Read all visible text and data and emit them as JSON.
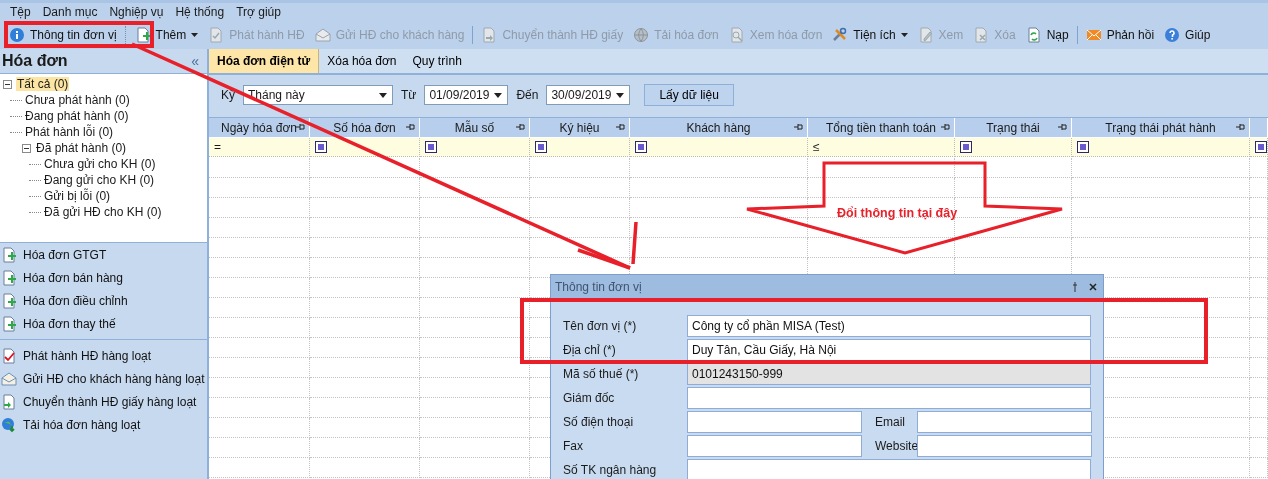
{
  "menu": [
    "Tệp",
    "Danh mục",
    "Nghiệp vụ",
    "Hệ thống",
    "Trợ giúp"
  ],
  "toolbar": [
    [
      {
        "label": "Thông tin đơn vị",
        "disabled": false,
        "dropdown": false
      }
    ],
    [
      {
        "label": "Thêm",
        "disabled": false,
        "dropdown": true
      },
      {
        "label": "Phát hành HĐ",
        "disabled": true,
        "dropdown": false
      },
      {
        "label": "Gửi HĐ cho khách hàng",
        "disabled": true,
        "dropdown": false
      }
    ],
    [
      {
        "label": "Chuyển thành HĐ giấy",
        "disabled": true,
        "dropdown": false
      },
      {
        "label": "Tải hóa đơn",
        "disabled": true,
        "dropdown": false
      },
      {
        "label": "Xem hóa đơn",
        "disabled": true,
        "dropdown": false
      },
      {
        "label": "Tiện ích",
        "disabled": false,
        "dropdown": true
      },
      {
        "label": "Xem",
        "disabled": true,
        "dropdown": false
      },
      {
        "label": "Xóa",
        "disabled": true,
        "dropdown": false
      },
      {
        "label": "Nạp",
        "disabled": false,
        "dropdown": false
      }
    ],
    [
      {
        "label": "Phản hồi",
        "disabled": false,
        "dropdown": false
      },
      {
        "label": "Giúp",
        "disabled": false,
        "dropdown": false
      }
    ]
  ],
  "sidebar": {
    "title": "Hóa đơn",
    "collapse": "«",
    "tree": [
      {
        "label": "Tất cả (0)",
        "selected": true,
        "expanded": true,
        "children": [
          {
            "label": "Chưa phát hành (0)",
            "selected": false
          },
          {
            "label": "Đang phát hành (0)",
            "selected": false
          },
          {
            "label": "Phát hành lỗi (0)",
            "selected": false
          },
          {
            "label": "Đã phát hành (0)",
            "selected": false,
            "expanded": true,
            "children": [
              {
                "label": "Chưa gửi cho KH (0)",
                "selected": false
              },
              {
                "label": "Đang gửi cho KH (0)",
                "selected": false
              },
              {
                "label": "Gửi bị lỗi (0)",
                "selected": false
              },
              {
                "label": "Đã gửi HĐ cho KH (0)",
                "selected": false
              }
            ]
          }
        ]
      }
    ],
    "actions": [
      [
        "Hóa đơn GTGT",
        "Hóa đơn bán hàng",
        "Hóa đơn điều chỉnh",
        "Hóa đơn thay thế"
      ],
      [
        "Phát hành HĐ hàng loạt",
        "Gửi HĐ cho khách hàng hàng loạt",
        "Chuyển thành HĐ giấy hàng loạt",
        "Tải hóa đơn hàng loạt"
      ]
    ]
  },
  "tabs": [
    {
      "label": "Hóa đơn điện tử",
      "selected": true
    },
    {
      "label": "Xóa hóa đơn",
      "selected": false
    },
    {
      "label": "Quy trình",
      "selected": false
    }
  ],
  "filter": {
    "period_label": "Kỳ",
    "period": "Tháng này",
    "from_label": "Từ",
    "from": "01/09/2019",
    "to_label": "Đến",
    "to": "30/09/2019",
    "button": "Lấy dữ liệu"
  },
  "table": {
    "columns": [
      "Ngày hóa đơn",
      "Số hóa đơn",
      "Mẫu số",
      "Ký hiệu",
      "Khách hàng",
      "Tổng tiền thanh toán",
      "Trạng thái",
      "Trạng thái phát hành"
    ],
    "filter_row": [
      {
        "kind": "operator",
        "text": "="
      },
      {
        "kind": "icon"
      },
      {
        "kind": "icon"
      },
      {
        "kind": "icon"
      },
      {
        "kind": "icon"
      },
      {
        "kind": "operator",
        "text": "≤"
      },
      {
        "kind": "icon"
      },
      {
        "kind": "icon"
      },
      {
        "kind": "icon"
      }
    ]
  },
  "dialog": {
    "title": "Thông tin đơn vị",
    "rows": [
      [
        {
          "label": "Tên đơn vị (*)",
          "value": "Công ty cổ phần MISA (Test)",
          "disabled": false
        }
      ],
      [
        {
          "label": "Địa chỉ (*)",
          "value": "Duy Tân, Cầu Giấy, Hà Nội",
          "disabled": false
        }
      ],
      [
        {
          "label": "Mã số thuế (*)",
          "value": "0101243150-999",
          "disabled": true
        }
      ],
      [
        {
          "label": "Giám đốc",
          "disabled": false
        }
      ],
      [
        {
          "label": "Số điện thoại",
          "disabled": false
        },
        {
          "label": "Email",
          "disabled": false
        }
      ],
      [
        {
          "label": "Fax",
          "disabled": false
        },
        {
          "label": "Website",
          "disabled": false
        }
      ],
      [
        {
          "label": "Số TK ngân hàng",
          "disabled": false
        }
      ]
    ]
  },
  "annotation": {
    "text": "Đổi thông tin tại đây"
  }
}
